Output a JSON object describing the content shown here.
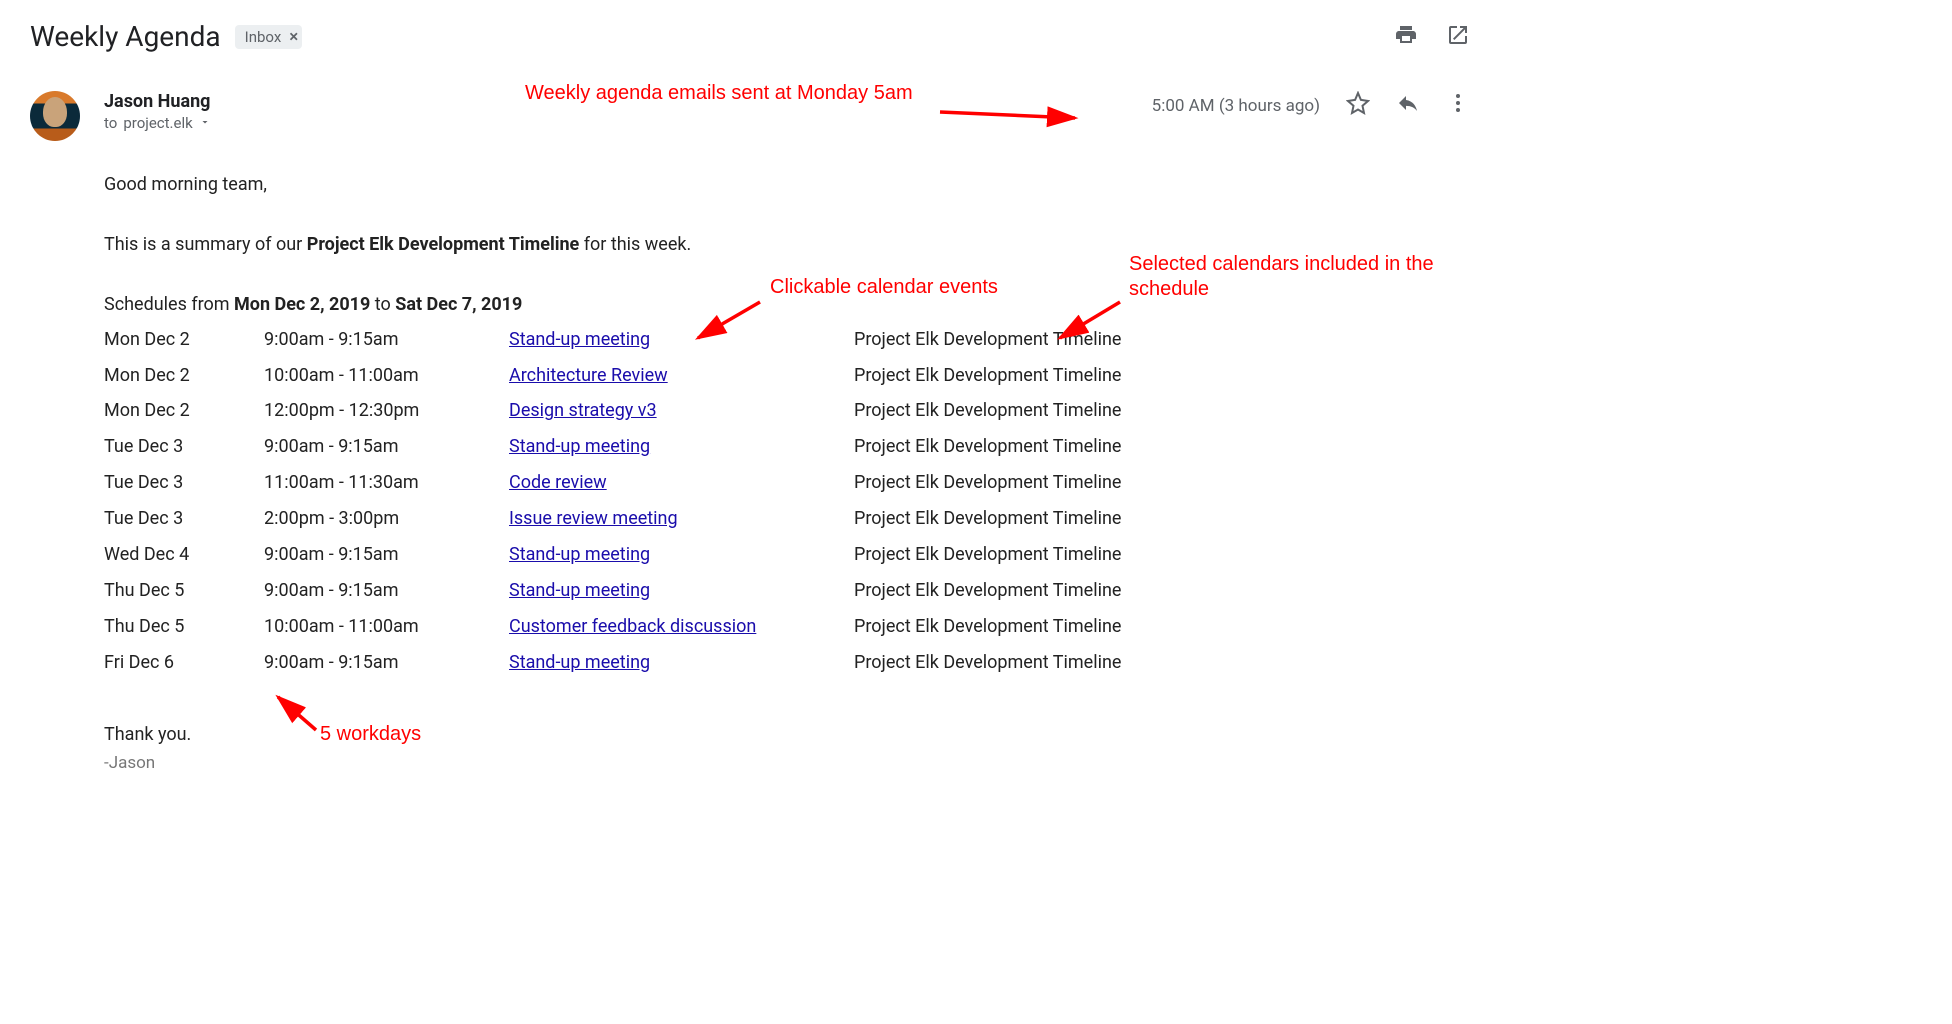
{
  "header": {
    "subject": "Weekly Agenda",
    "chip_label": "Inbox",
    "chip_close": "×"
  },
  "sender": {
    "name": "Jason Huang",
    "to_prefix": "to ",
    "to": "project.elk",
    "timestamp": "5:00 AM (3 hours ago)"
  },
  "body": {
    "greeting": "Good morning team,",
    "intro_pre": "This is a summary of our ",
    "intro_bold": "Project Elk Development Timeline",
    "intro_post": " for this week.",
    "sched_pre": "Schedules from ",
    "sched_from": "Mon Dec 2, 2019",
    "sched_mid": " to ",
    "sched_to": "Sat Dec 7, 2019",
    "thanks": "Thank you.",
    "signature": "-Jason"
  },
  "schedule": [
    {
      "date": "Mon Dec 2",
      "time": "9:00am - 9:15am",
      "event": "Stand-up meeting",
      "calendar": "Project Elk Development Timeline"
    },
    {
      "date": "Mon Dec 2",
      "time": "10:00am - 11:00am",
      "event": "Architecture Review",
      "calendar": "Project Elk Development Timeline"
    },
    {
      "date": "Mon Dec 2",
      "time": "12:00pm - 12:30pm",
      "event": "Design strategy v3",
      "calendar": "Project Elk Development Timeline"
    },
    {
      "date": "Tue Dec 3",
      "time": "9:00am - 9:15am",
      "event": "Stand-up meeting",
      "calendar": "Project Elk Development Timeline"
    },
    {
      "date": "Tue Dec 3",
      "time": "11:00am - 11:30am",
      "event": "Code review",
      "calendar": "Project Elk Development Timeline"
    },
    {
      "date": "Tue Dec 3",
      "time": "2:00pm - 3:00pm",
      "event": "Issue review meeting",
      "calendar": "Project Elk Development Timeline"
    },
    {
      "date": "Wed Dec 4",
      "time": "9:00am - 9:15am",
      "event": "Stand-up meeting",
      "calendar": "Project Elk Development Timeline"
    },
    {
      "date": "Thu Dec 5",
      "time": "9:00am - 9:15am",
      "event": "Stand-up meeting",
      "calendar": "Project Elk Development Timeline"
    },
    {
      "date": "Thu Dec 5",
      "time": "10:00am - 11:00am",
      "event": "Customer feedback discussion",
      "calendar": "Project Elk Development Timeline"
    },
    {
      "date": "Fri Dec 6",
      "time": "9:00am - 9:15am",
      "event": "Stand-up meeting",
      "calendar": "Project Elk Development Timeline"
    }
  ],
  "annotations": {
    "a1": "Weekly agenda emails sent at Monday 5am",
    "a2": "Clickable calendar events",
    "a3": "Selected calendars included in the schedule",
    "a4": "5 workdays"
  }
}
